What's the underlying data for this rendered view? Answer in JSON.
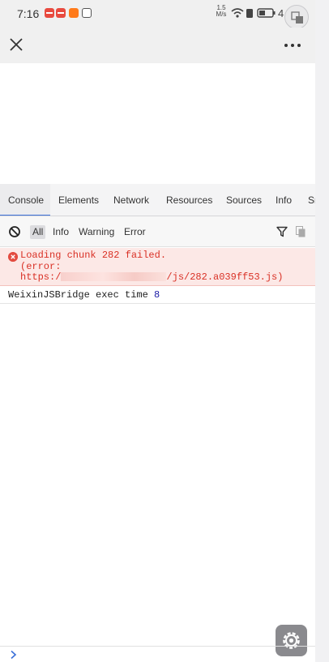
{
  "status_bar": {
    "time": "7:16",
    "net_speed_value": "1.5",
    "net_speed_unit": "M/s",
    "battery_text": "4",
    "accent_red": "#e84a3f"
  },
  "title_bar": {
    "close_icon": "close-icon",
    "more_icon": "more-icon"
  },
  "devtools": {
    "tabs": [
      {
        "label": "Console",
        "active": true
      },
      {
        "label": "Elements"
      },
      {
        "label": "Network"
      },
      {
        "label": "Resources"
      },
      {
        "label": "Sources"
      },
      {
        "label": "Info"
      },
      {
        "label": "Sn"
      }
    ],
    "filters": [
      "All",
      "Info",
      "Warning",
      "Error"
    ],
    "selected_filter": "All"
  },
  "console": {
    "error": {
      "line1": "Loading chunk 282 failed.",
      "line2": "(error:",
      "line3_prefix": "https:/",
      "line3_suffix": "/js/282.a039ff53.js)",
      "color": "#d93025"
    },
    "info": {
      "text": "WeixinJSBridge exec time ",
      "value": "8"
    }
  },
  "prompt": {
    "icon": "chevron-right-icon"
  }
}
